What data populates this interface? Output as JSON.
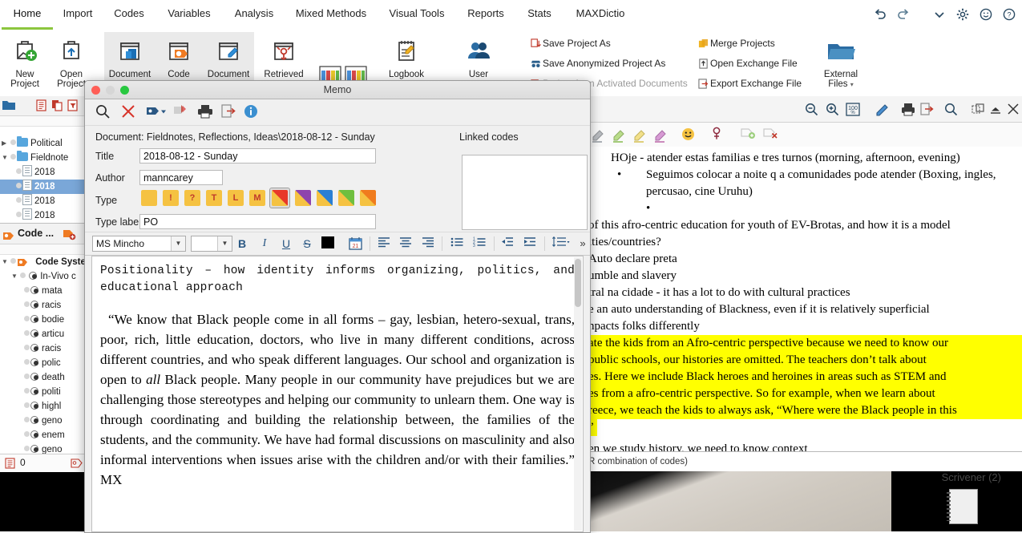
{
  "app": {
    "ribbon_tabs": [
      {
        "label": "Home",
        "active": true
      },
      {
        "label": "Import",
        "active": false
      },
      {
        "label": "Codes",
        "active": false
      },
      {
        "label": "Variables",
        "active": false
      },
      {
        "label": "Analysis",
        "active": false
      },
      {
        "label": "Mixed Methods",
        "active": false
      },
      {
        "label": "Visual Tools",
        "active": false
      },
      {
        "label": "Reports",
        "active": false
      },
      {
        "label": "Stats",
        "active": false
      },
      {
        "label": "MAXDictio",
        "active": false
      }
    ],
    "window_controls": [
      "undo-icon",
      "redo-icon",
      "chevron-down-icon",
      "gear-icon",
      "smiley-icon",
      "help-icon"
    ]
  },
  "ribbon": {
    "buttons": [
      {
        "id": "new-project",
        "line1": "New",
        "line2": "Project",
        "icon": "new-project-icon"
      },
      {
        "id": "open-project",
        "line1": "Open",
        "line2": "Project",
        "icon": "open-project-icon"
      },
      {
        "id": "document-browser",
        "line1": "Document",
        "line2": "",
        "icon": "document-browser-icon"
      },
      {
        "id": "code-system",
        "line1": "Code",
        "line2": "",
        "icon": "code-system-icon"
      },
      {
        "id": "document-memo",
        "line1": "Document",
        "line2": "",
        "icon": "document-memo-icon"
      },
      {
        "id": "retrieved-segments",
        "line1": "Retrieved",
        "line2": "",
        "icon": "retrieved-segments-icon"
      },
      {
        "id": "four-window",
        "line1": "",
        "line2": "",
        "icon": "four-window-icon"
      },
      {
        "id": "logbook",
        "line1": "Logbook",
        "line2": "",
        "icon": "logbook-icon"
      },
      {
        "id": "user",
        "line1": "User",
        "line2": "",
        "icon": "user-icon"
      }
    ],
    "commands_col1": [
      {
        "label": "Save Project As",
        "icon": "save-as-icon"
      },
      {
        "label": "Save Anonymized Project As",
        "icon": "anonymize-icon"
      },
      {
        "label": "Project from Activated Documents",
        "icon": "project-from-docs-icon"
      }
    ],
    "commands_col2": [
      {
        "label": "Merge Projects",
        "icon": "merge-icon"
      },
      {
        "label": "Open Exchange File",
        "icon": "open-exchange-icon"
      },
      {
        "label": "Export Exchange File",
        "icon": "export-exchange-icon"
      }
    ],
    "external_files": {
      "line1": "External",
      "line2": "Files",
      "icon": "external-files-icon"
    }
  },
  "document_system": {
    "toolbar_icons": [
      "document-list-icon",
      "duplicate-icon",
      "filter-doc-icon"
    ],
    "tree": [
      {
        "label": "Political",
        "depth": 1,
        "type": "folder",
        "expanded": false,
        "selected": false
      },
      {
        "label": "Fieldnote",
        "depth": 1,
        "type": "folder",
        "expanded": true,
        "selected": false
      },
      {
        "label": "2018",
        "depth": 2,
        "type": "doc",
        "selected": false
      },
      {
        "label": "2018",
        "depth": 2,
        "type": "doc-memo",
        "selected": true
      },
      {
        "label": "2018",
        "depth": 2,
        "type": "doc",
        "selected": false
      },
      {
        "label": "2018",
        "depth": 2,
        "type": "doc",
        "selected": false
      }
    ]
  },
  "code_system": {
    "title": "Code ...",
    "toolbar_icon": "new-code-icon",
    "tree": [
      {
        "label": "Code System",
        "depth": 0,
        "bold": true
      },
      {
        "label": "In-Vivo c",
        "depth": 1,
        "bold": false
      },
      {
        "label": "mata",
        "depth": 2,
        "bold": false
      },
      {
        "label": "racis",
        "depth": 2,
        "bold": false
      },
      {
        "label": "bodie",
        "depth": 2,
        "bold": false
      },
      {
        "label": "articu",
        "depth": 2,
        "bold": false
      },
      {
        "label": "racis",
        "depth": 2,
        "bold": false
      },
      {
        "label": "polic",
        "depth": 2,
        "bold": false
      },
      {
        "label": "death",
        "depth": 2,
        "bold": false
      },
      {
        "label": "politi",
        "depth": 2,
        "bold": false
      },
      {
        "label": "highl",
        "depth": 2,
        "bold": false
      },
      {
        "label": "geno",
        "depth": 2,
        "bold": false
      },
      {
        "label": "enem",
        "depth": 2,
        "bold": false
      },
      {
        "label": "geno",
        "depth": 2,
        "bold": false
      }
    ],
    "status_count": "0"
  },
  "memo": {
    "window_title": "Memo",
    "toolbar_icons": [
      "search-icon",
      "delete-icon",
      "code-tag-icon",
      "insert-memo-icon",
      "print-icon",
      "export-icon",
      "info-icon"
    ],
    "document_path_label": "Document: Fieldnotes, Reflections, Ideas\\2018-08-12 - Sunday",
    "linked_codes_label": "Linked codes",
    "fields": {
      "title_label": "Title",
      "title_value": "2018-08-12 - Sunday",
      "author_label": "Author",
      "author_value": "manncarey",
      "type_label": "Type",
      "type_label_label": "Type label",
      "type_label_value": "PO"
    },
    "type_tiles": [
      {
        "name": "plain",
        "letter": "",
        "colors": [
          "#f5c242",
          "#f5c242"
        ],
        "selected": false
      },
      {
        "name": "exclamation",
        "letter": "!",
        "colors": [
          "#f5c242",
          "#f5c242"
        ],
        "selected": false
      },
      {
        "name": "question",
        "letter": "?",
        "colors": [
          "#f5c242",
          "#f5c242"
        ],
        "selected": false
      },
      {
        "name": "theory",
        "letter": "T",
        "colors": [
          "#f5c242",
          "#f5c242"
        ],
        "selected": false
      },
      {
        "name": "literature",
        "letter": "L",
        "colors": [
          "#f5c242",
          "#f5c242"
        ],
        "selected": false
      },
      {
        "name": "method",
        "letter": "M",
        "colors": [
          "#f5c242",
          "#f5c242"
        ],
        "selected": false
      },
      {
        "name": "red",
        "letter": "",
        "colors": [
          "#e8392a",
          "#f5c242"
        ],
        "selected": true
      },
      {
        "name": "purple",
        "letter": "",
        "colors": [
          "#8e44ad",
          "#f5c242"
        ],
        "selected": false
      },
      {
        "name": "blue",
        "letter": "",
        "colors": [
          "#2a7fd4",
          "#f5c242"
        ],
        "selected": false
      },
      {
        "name": "green",
        "letter": "",
        "colors": [
          "#6fbf3f",
          "#f5c242"
        ],
        "selected": false
      },
      {
        "name": "orange",
        "letter": "",
        "colors": [
          "#f07c1e",
          "#f5c242"
        ],
        "selected": false
      }
    ],
    "format_toolbar": {
      "font_family": "MS Mincho",
      "font_size": "",
      "buttons": [
        "bold",
        "italic",
        "underline",
        "strikethrough",
        "text-color",
        "insert-date",
        "align-left",
        "align-center",
        "align-right",
        "bullet-list",
        "numbered-list",
        "outdent",
        "indent",
        "line-spacing",
        "overflow"
      ],
      "text_color": "#000000"
    },
    "content": {
      "heading": "Positionality – how identity informs organizing, politics, and educational approach",
      "paragraph_1a": "“We know that Black people come in all forms – gay, lesbian, hetero-sexual, trans, poor, rich, little education, doctors, who live in many different conditions, across different countries, and who speak different languages. Our school and organization is open to ",
      "paragraph_italic": "all",
      "paragraph_1b": " Black people. Many people in our community have prejudices but we are challenging those stereotypes and helping our community to unlearn them. One way is through coordinating and building the relationship between, the families of the students, and the community. We have had formal discussions on masculinity and also informal interventions when issues arise with the children and/or with their families.” MX"
    }
  },
  "document_browser": {
    "toolbar_icons_right": [
      "zoom-out-icon",
      "zoom-in-icon",
      "zoom-100-icon",
      "edit-icon",
      "print-icon",
      "export-icon",
      "search-icon",
      "detach-icon",
      "collapse-icon",
      "close-icon"
    ],
    "highlighter_icons": [
      "highlighter-grey-icon",
      "highlighter-green-icon",
      "highlighter-yellow-icon",
      "highlighter-pink-icon",
      "emoji-icon",
      "symbol-icon",
      "add-comment-icon",
      "remove-comment-icon"
    ],
    "lines": [
      {
        "text": "HOje - atender estas familias e tres turnos (morning, afternoon, evening)",
        "indent": 1,
        "bullet": false,
        "highlight": false
      },
      {
        "text": "Seguimos colocar a noite q a comunidades pode atender (Boxing, ingles, percusao, cine Uruhu)",
        "indent": 2,
        "bullet": true,
        "highlight": false
      },
      {
        "text": "",
        "indent": 2,
        "bullet": true,
        "highlight": false
      },
      {
        "text": "of this afro-centric education for youth of EV-Brotas, and how it is a model",
        "indent": 0,
        "bullet": false,
        "highlight": false
      },
      {
        "text": "ities/countries?",
        "indent": 0,
        "bullet": false,
        "highlight": false
      },
      {
        "text": "Auto declare preta",
        "indent": 0,
        "bullet": false,
        "highlight": false
      },
      {
        "text": "umble and slavery",
        "indent": 0,
        "bullet": false,
        "highlight": false
      },
      {
        "text": "tral na cidade - it has a lot to do with cultural practices",
        "indent": 0,
        "bullet": false,
        "highlight": false
      },
      {
        "text": "e an auto understanding of Blackness, even if it is relatively superficial",
        "indent": 0,
        "bullet": false,
        "highlight": false
      },
      {
        "text": "npacts folks differently",
        "indent": 0,
        "bullet": false,
        "highlight": false
      },
      {
        "text": "ate the kids from an Afro-centric perspective because we need to know our",
        "indent": 0,
        "bullet": false,
        "highlight": true
      },
      {
        "text": "public schools, our histories are omitted. The teachers don’t talk about",
        "indent": 0,
        "bullet": false,
        "highlight": true
      },
      {
        "text": "es. Here we include Black heroes and heroines in areas such as STEM and",
        "indent": 0,
        "bullet": false,
        "highlight": true
      },
      {
        "text": "es from a afro-centric perspective. So for example, when we learn about",
        "indent": 0,
        "bullet": false,
        "highlight": true
      },
      {
        "text": "reece, we teach the kids to always ask, “Where were the Black people in this",
        "indent": 0,
        "bullet": false,
        "highlight": true
      },
      {
        "text": "”",
        "indent": 0,
        "bullet": false,
        "highlight": true
      },
      {
        "text": "en we study history, we need to know context",
        "indent": 0,
        "bullet": false,
        "highlight": false
      }
    ],
    "footer_text": "R combination of codes)"
  },
  "desktop": {
    "scrivener_label": "Scrivener (2)"
  },
  "colors": {
    "accent_green": "#8cc63e",
    "highlight_yellow": "#ffff00",
    "selection_blue": "#7aa7d8",
    "ribbon_blue": "#2a5783"
  }
}
